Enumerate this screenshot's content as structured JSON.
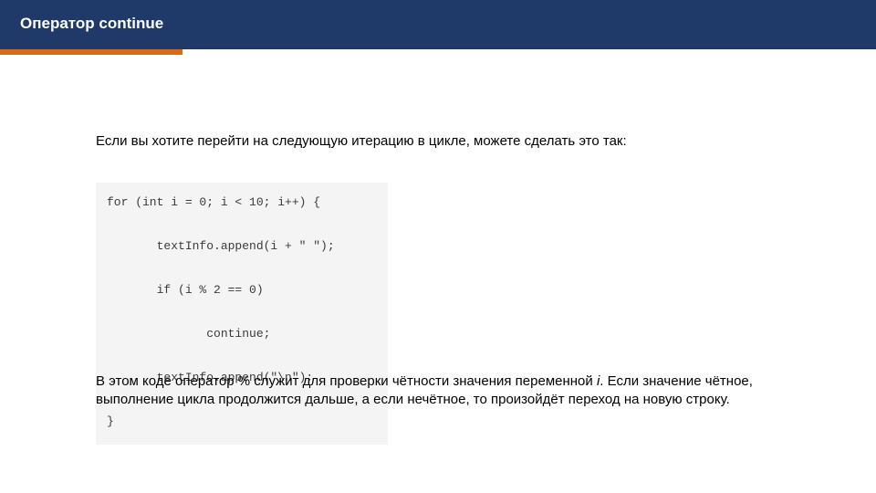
{
  "header": {
    "title": "Оператор continue"
  },
  "intro": {
    "text": "Если вы хотите перейти на следующую итерацию в цикле, можете сделать это так:"
  },
  "code": {
    "line1": "for (int i = 0; i < 10; i++) {",
    "line2": "       textInfo.append(i + \" \");",
    "line3": "       if (i % 2 == 0)",
    "line4": "              continue;",
    "line5": "       textInfo.append(\"\\n\");",
    "line6": "}"
  },
  "outro": {
    "part1": "В этом коде оператор % служит для проверки чётности значения переменной ",
    "var": "i",
    "part2": ". Если значение чётное, выполнение цикла продолжится дальше, а если нечётное, то произойдёт переход на новую строку."
  }
}
